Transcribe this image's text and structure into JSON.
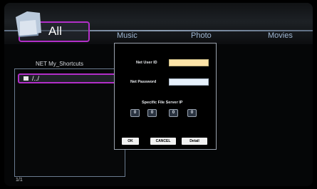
{
  "tabs": {
    "all": "All",
    "music": "Music",
    "photo": "Photo",
    "movies": "Movies"
  },
  "shortcuts": {
    "title": "NET My_Shortcuts",
    "items": [
      {
        "label": "/../"
      }
    ],
    "page": "1/1"
  },
  "dialog": {
    "user_id_label": "Net User ID",
    "user_id_value": "",
    "password_label": "Net Password",
    "password_value": "",
    "server_ip_label": "Specific File Server IP",
    "ip_octets": [
      "0",
      "0",
      "0",
      "0"
    ],
    "ok_label": "OK",
    "cancel_label": "CANCEL",
    "detail_label": "Detail"
  },
  "colors": {
    "focus_highlight": "#b22fc8",
    "user_id_field": "#fde4a8",
    "password_field": "#e6f0fb",
    "tab_text": "#9fb7d3"
  }
}
